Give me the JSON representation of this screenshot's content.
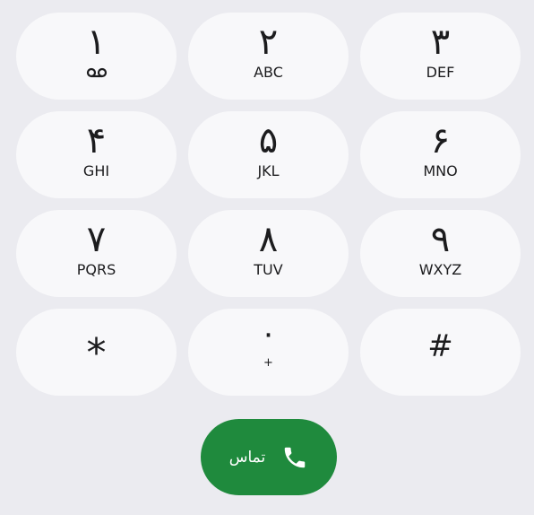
{
  "keypad": {
    "keys": [
      {
        "digit": "١",
        "letters": ""
      },
      {
        "digit": "٢",
        "letters": "ABC"
      },
      {
        "digit": "٣",
        "letters": "DEF"
      },
      {
        "digit": "۴",
        "letters": "GHI"
      },
      {
        "digit": "۵",
        "letters": "JKL"
      },
      {
        "digit": "۶",
        "letters": "MNO"
      },
      {
        "digit": "٧",
        "letters": "PQRS"
      },
      {
        "digit": "٨",
        "letters": "TUV"
      },
      {
        "digit": "٩",
        "letters": "WXYZ"
      },
      {
        "digit": "*",
        "letters": ""
      },
      {
        "digit": "٠",
        "letters": "+"
      },
      {
        "digit": "#",
        "letters": ""
      }
    ],
    "voicemail_icon": "voicemail-icon"
  },
  "call": {
    "label": "تماس",
    "icon": "phone-icon",
    "color": "#1f8a3d"
  },
  "colors": {
    "background": "#ebebf0",
    "key_background": "#f8f8fa",
    "text": "#1c1c1e"
  }
}
